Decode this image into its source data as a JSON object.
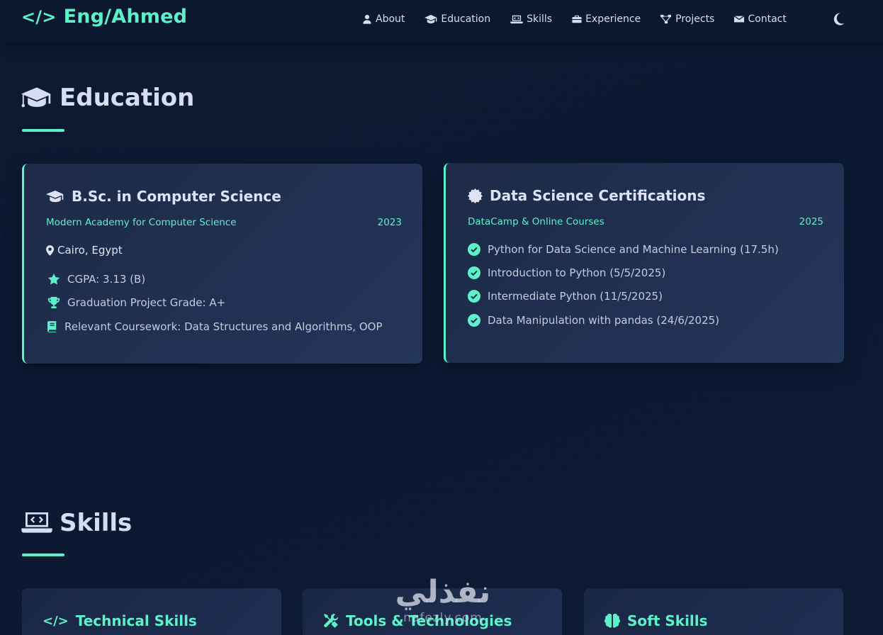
{
  "navbar": {
    "brand": "Eng/Ahmed",
    "items": [
      {
        "label": "About",
        "icon": "user-icon"
      },
      {
        "label": "Education",
        "icon": "graduation-cap-icon"
      },
      {
        "label": "Skills",
        "icon": "laptop-code-icon"
      },
      {
        "label": "Experience",
        "icon": "briefcase-icon"
      },
      {
        "label": "Projects",
        "icon": "project-diagram-icon"
      },
      {
        "label": "Contact",
        "icon": "envelope-icon"
      }
    ],
    "theme_icon": "moon-icon"
  },
  "education": {
    "title": "Education",
    "cards": [
      {
        "title": "B.Sc. in Computer Science",
        "institution": "Modern Academy for Computer Science",
        "year": "2023",
        "location": "Cairo, Egypt",
        "items": [
          {
            "icon": "star-icon",
            "text": "CGPA: 3.13 (B)"
          },
          {
            "icon": "trophy-icon",
            "text": "Graduation Project Grade: A+"
          },
          {
            "icon": "book-icon",
            "text": "Relevant Coursework: Data Structures and Algorithms, OOP"
          }
        ]
      },
      {
        "title": "Data Science Certifications",
        "institution": "DataCamp & Online Courses",
        "year": "2025",
        "items": [
          {
            "icon": "check-circle-icon",
            "text": "Python for Data Science and Machine Learning (17.5h)"
          },
          {
            "icon": "check-circle-icon",
            "text": "Introduction to Python (5/5/2025)"
          },
          {
            "icon": "check-circle-icon",
            "text": "Intermediate Python (11/5/2025)"
          },
          {
            "icon": "check-circle-icon",
            "text": "Data Manipulation with pandas (24/6/2025)"
          }
        ]
      }
    ]
  },
  "skills": {
    "title": "Skills",
    "cards": [
      {
        "title": "Technical Skills",
        "icon": "code-icon"
      },
      {
        "title": "Tools & Technologies",
        "icon": "tools-icon"
      },
      {
        "title": "Soft Skills",
        "icon": "brain-icon"
      }
    ]
  },
  "watermark": {
    "arabic": "نفذلي",
    "latin": "nafezly.com"
  },
  "colors": {
    "accent": "#5ef0c8",
    "background": "#0b1933",
    "card": "#22314f",
    "text": "#d6ddf3"
  }
}
